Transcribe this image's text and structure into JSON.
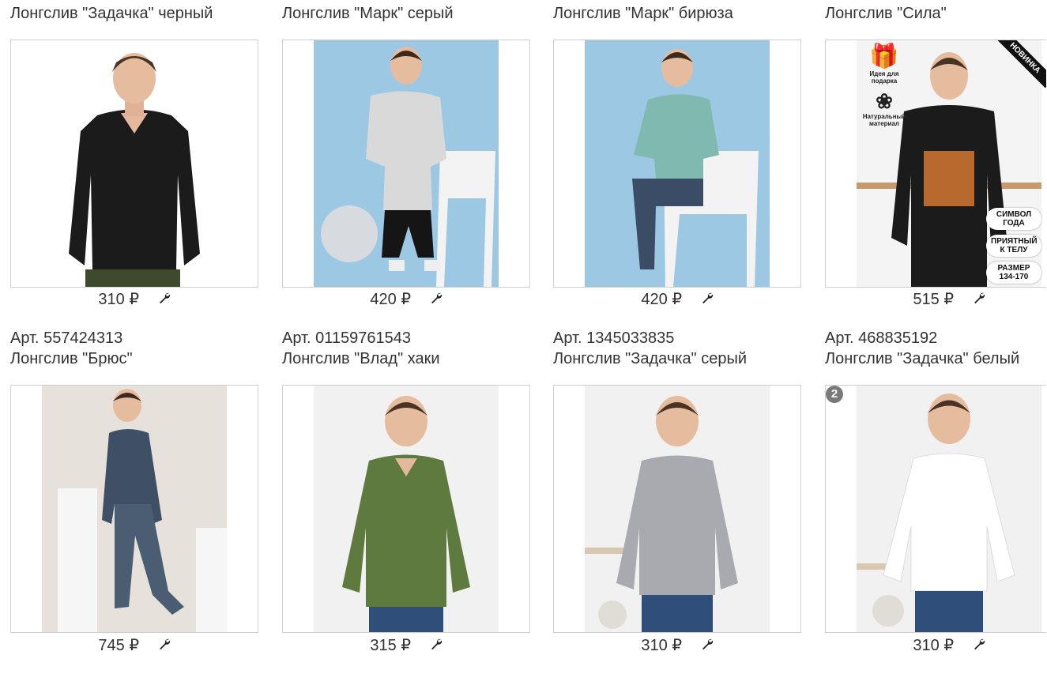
{
  "products": [
    {
      "art": "",
      "title": "Лонгслив \"Задачка\" черный",
      "price": "310 ₽",
      "photo": "black-vneck"
    },
    {
      "art": "",
      "title": "Лонгслив \"Марк\" серый",
      "price": "420 ₽",
      "photo": "grey-print"
    },
    {
      "art": "",
      "title": "Лонгслив \"Марк\" бирюза",
      "price": "420 ₽",
      "photo": "teal-print"
    },
    {
      "art": "",
      "title": "Лонгслив \"Сила\"",
      "price": "515 ₽",
      "photo": "black-tiger",
      "stickers": {
        "gift": "Идея для подарка",
        "natural": "Натуральный материал",
        "new": "НОВИНКА",
        "pills": [
          "СИМВОЛ ГОДА",
          "ПРИЯТНЫЙ К ТЕЛУ",
          "РАЗМЕР 134-170"
        ]
      }
    },
    {
      "art": "Арт. 557424313",
      "title": "Лонгслив \"Брюс\"",
      "price": "745 ₽",
      "photo": "navy-lucky"
    },
    {
      "art": "Арт. 01159761543",
      "title": "Лонгслив \"Влад\" хаки",
      "price": "315 ₽",
      "photo": "khaki"
    },
    {
      "art": "Арт. 1345033835",
      "title": "Лонгслив \"Задачка\" серый",
      "price": "310 ₽",
      "photo": "grey"
    },
    {
      "art": "Арт. 468835192",
      "title": "Лонгслив \"Задачка\" белый",
      "price": "310 ₽",
      "photo": "white",
      "badge": "2"
    }
  ],
  "colors": {
    "black": "#1b1b1b",
    "grey_print": "#d9d9d9",
    "teal": "#7fb9b0",
    "navy": "#3f5066",
    "khaki": "#5f7a3e",
    "grey": "#a8aab0",
    "white": "#f7f7f7",
    "blue_bg": "#9cc8e4",
    "brick": "#f1f1f1"
  }
}
